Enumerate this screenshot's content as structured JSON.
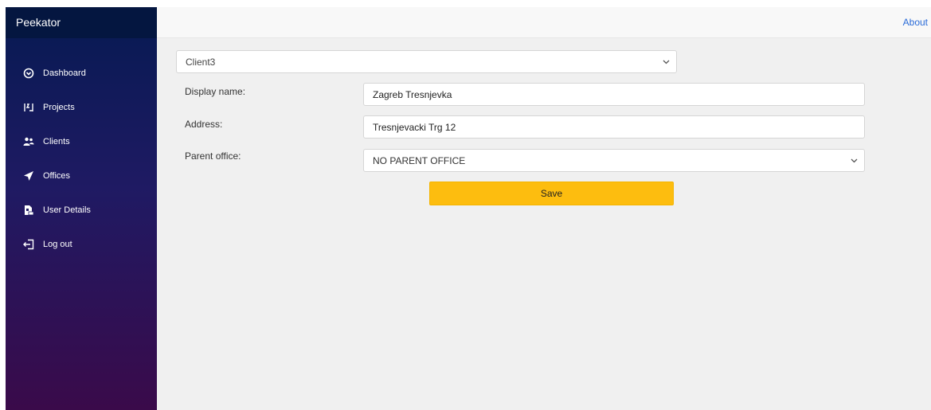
{
  "app": {
    "brand": "Peekator"
  },
  "sidebar": {
    "items": [
      {
        "label": "Dashboard",
        "icon": "dashboard-icon"
      },
      {
        "label": "Projects",
        "icon": "projects-icon"
      },
      {
        "label": "Clients",
        "icon": "clients-icon"
      },
      {
        "label": "Offices",
        "icon": "offices-icon"
      },
      {
        "label": "User Details",
        "icon": "user-details-icon"
      },
      {
        "label": "Log out",
        "icon": "logout-icon"
      }
    ]
  },
  "header": {
    "about_label": "About"
  },
  "main": {
    "client_select": {
      "selected": "Client3"
    },
    "form": {
      "display_name": {
        "label": "Display name:",
        "value": "Zagreb Tresnjevka"
      },
      "address": {
        "label": "Address:",
        "value": "Tresnjevacki Trg 12"
      },
      "parent_office": {
        "label": "Parent office:",
        "selected": "NO PARENT OFFICE"
      }
    },
    "save_label": "Save"
  },
  "colors": {
    "sidebar_top": "#061a52",
    "sidebar_bottom": "#3a0a4a",
    "accent_button": "#fdbd0f",
    "link": "#2a6bd8",
    "content_bg": "#f0f0f0"
  }
}
